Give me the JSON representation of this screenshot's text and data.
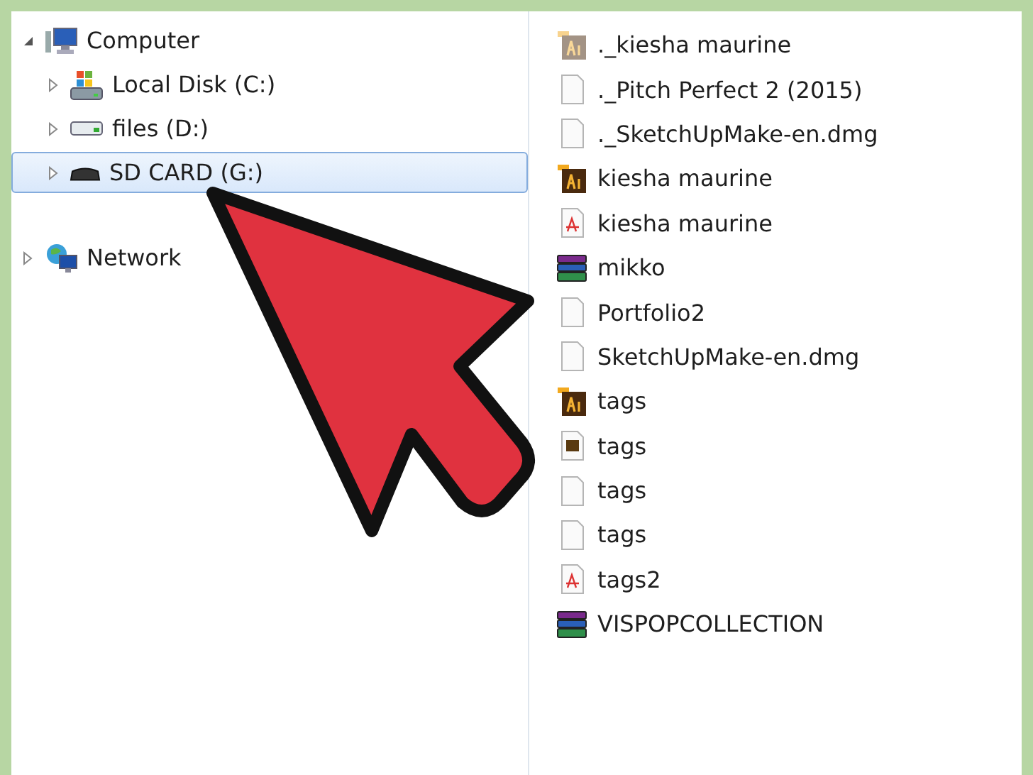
{
  "tree": [
    {
      "label": "Computer",
      "kind": "computer",
      "expanded": true,
      "selected": false,
      "children": [
        {
          "label": "Local Disk (C:)",
          "kind": "system-disk",
          "expanded": false,
          "selected": false
        },
        {
          "label": "files (D:)",
          "kind": "drive",
          "expanded": false,
          "selected": false
        },
        {
          "label": "SD CARD (G:)",
          "kind": "card",
          "expanded": false,
          "selected": true
        }
      ]
    },
    {
      "label": "Network",
      "kind": "network",
      "expanded": false,
      "selected": false
    }
  ],
  "files": [
    {
      "name": "._kiesha maurine",
      "kind": "ai-faded"
    },
    {
      "name": "._Pitch Perfect 2 (2015)",
      "kind": "blank"
    },
    {
      "name": "._SketchUpMake-en.dmg",
      "kind": "blank"
    },
    {
      "name": "kiesha maurine",
      "kind": "ai"
    },
    {
      "name": "kiesha maurine",
      "kind": "pdf"
    },
    {
      "name": "mikko",
      "kind": "archive"
    },
    {
      "name": "Portfolio2",
      "kind": "blank"
    },
    {
      "name": "SketchUpMake-en.dmg",
      "kind": "blank"
    },
    {
      "name": "tags",
      "kind": "ai"
    },
    {
      "name": "tags",
      "kind": "ai-doc"
    },
    {
      "name": "tags",
      "kind": "blank"
    },
    {
      "name": "tags",
      "kind": "blank"
    },
    {
      "name": "tags2",
      "kind": "pdf"
    },
    {
      "name": "VISPOPCOLLECTION",
      "kind": "archive"
    }
  ]
}
